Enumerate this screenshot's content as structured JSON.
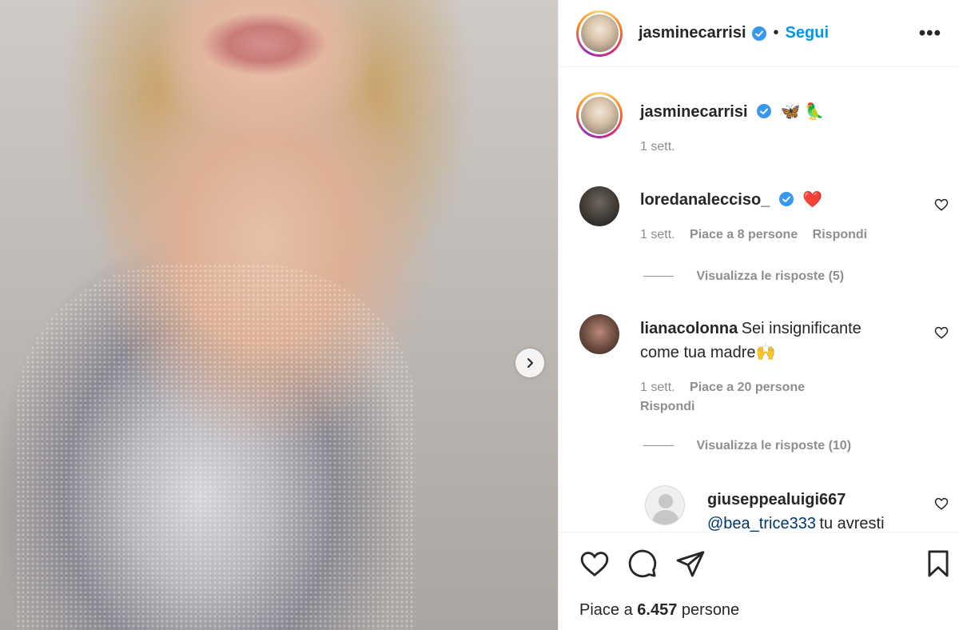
{
  "post": {
    "username": "jasminecarrisi",
    "follow_label": "Segui",
    "dot": "•",
    "more_label": "•••"
  },
  "caption": {
    "username": "jasminecarrisi",
    "text": "🦋 🦜",
    "time": "1 sett."
  },
  "comments": [
    {
      "username": "loredanalecciso_",
      "text": "❤️",
      "time": "1 sett.",
      "likes": "Piace a 8 persone",
      "reply_label": "Rispondi",
      "view_replies": "Visualizza le risposte (5)"
    },
    {
      "username": "lianacolonna",
      "text_line1": "Sei insignificante",
      "text_line2": "come tua madre🙌",
      "time": "1 sett.",
      "likes": "Piace a 20 persone",
      "reply_label": "Rispondi",
      "view_replies": "Visualizza le risposte (10)"
    },
    {
      "username": "giuseppealuigi667",
      "mention": "@bea_trice333",
      "text": "tu avresti"
    }
  ],
  "footer": {
    "likes_prefix": "Piace a",
    "likes_count": "6.457",
    "likes_suffix": "persone"
  },
  "colors": {
    "accent": "#0095f6",
    "verified": "#3897f0",
    "muted": "#8e8e8e"
  }
}
